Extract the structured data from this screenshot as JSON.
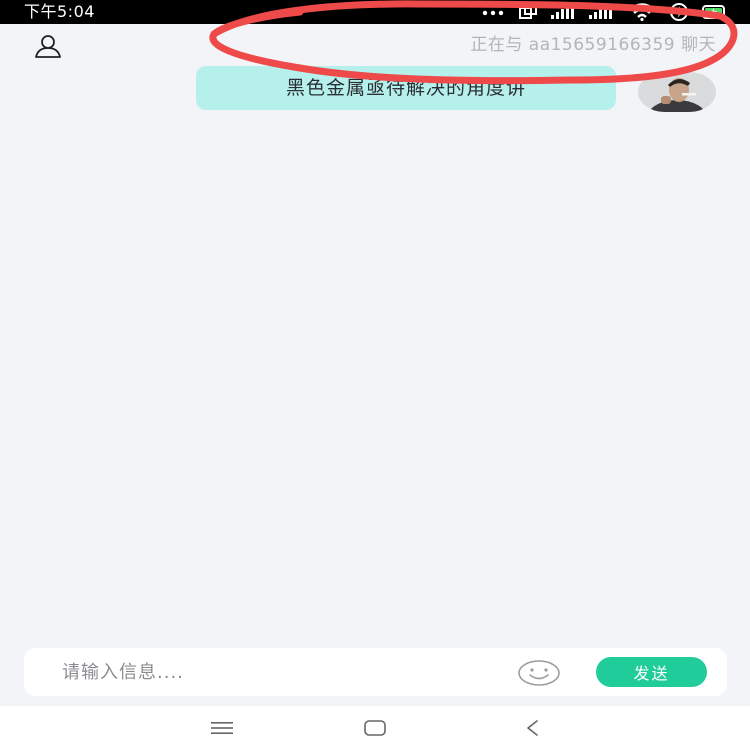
{
  "status_bar": {
    "time": "下午5:04",
    "icons": [
      "more-dots-icon",
      "screen-icon",
      "signal-icon",
      "hd-signal-icon",
      "wifi-icon",
      "data-icon",
      "battery-icon"
    ]
  },
  "header": {
    "user_icon": "person-icon",
    "chat_title": "正在与 aa15659166359 聊天"
  },
  "messages": [
    {
      "text": "黑色金属亟待解决的角度讲",
      "from": "self",
      "avatar": "avatar"
    }
  ],
  "input": {
    "placeholder": "请输入信息....",
    "value": "",
    "emoji_icon": "smiley-icon",
    "send_label": "发送"
  },
  "nav_bar": {
    "icons": [
      "menu-icon",
      "home-icon",
      "back-icon"
    ]
  },
  "colors": {
    "background": "#f3f4f7",
    "bubble": "#b6f0ed",
    "send_button": "#21cc9b",
    "annotation_stroke": "#ef4a4a",
    "status_bar": "#000000"
  }
}
